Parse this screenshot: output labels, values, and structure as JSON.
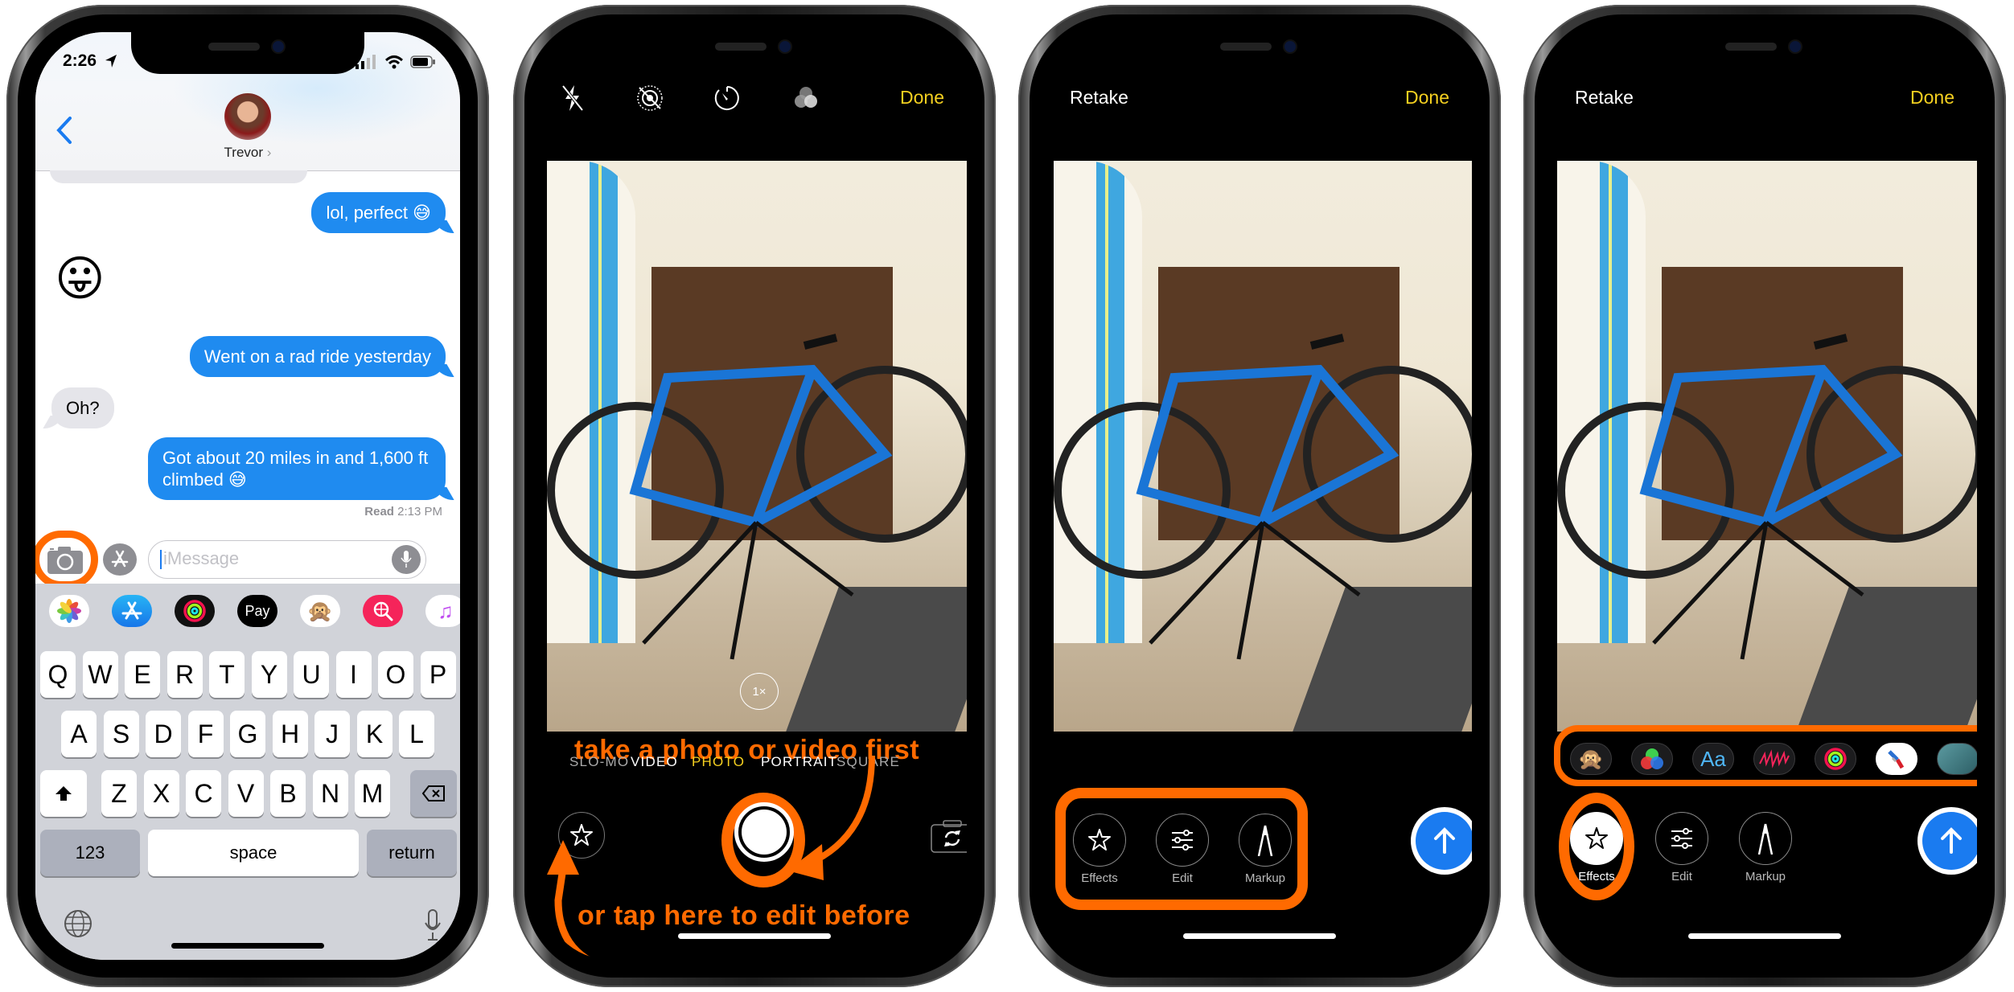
{
  "colors": {
    "imessage_blue": "#1f8bf0",
    "received_gray": "#e5e5ea",
    "annotation_orange": "#ff6a00",
    "camera_yellow": "#f5d020",
    "send_blue": "#1a7bf0"
  },
  "phone1": {
    "status": {
      "time": "2:26",
      "location_icon": "location-arrow-icon",
      "signal_icon": "signal-bars-icon",
      "wifi_icon": "wifi-icon",
      "battery_icon": "battery-icon"
    },
    "header": {
      "back_icon": "chevron-left-icon",
      "contact_name": "Trevor",
      "contact_chevron": "›",
      "avatar": "contact-photo"
    },
    "messages": [
      {
        "direction": "outgoing",
        "text": "lol, perfect 😅"
      },
      {
        "direction": "incoming",
        "text": "😛",
        "type": "emoji-only"
      },
      {
        "direction": "outgoing",
        "text": "Went on a rad ride yesterday"
      },
      {
        "direction": "incoming",
        "text": "Oh?"
      },
      {
        "direction": "outgoing",
        "text": "Got about 20 miles in and 1,600 ft climbed 😅"
      }
    ],
    "read_receipt": {
      "label": "Read",
      "time": "2:13 PM"
    },
    "compose": {
      "camera_icon": "camera-icon",
      "apps_icon": "app-store-icon",
      "placeholder": "iMessage",
      "mic_icon": "microphone-icon"
    },
    "app_strip": [
      {
        "name": "Photos",
        "icon": "photos-icon"
      },
      {
        "name": "App Store",
        "icon": "app-store-icon"
      },
      {
        "name": "Activity",
        "icon": "activity-rings-icon"
      },
      {
        "name": "Apple Pay",
        "label": "Pay",
        "icon": "apple-pay-icon"
      },
      {
        "name": "Animoji",
        "icon": "monkey-animoji-icon"
      },
      {
        "name": "Images",
        "icon": "search-globe-icon"
      },
      {
        "name": "Music",
        "icon": "music-note-icon"
      }
    ],
    "keyboard": {
      "row1": [
        "Q",
        "W",
        "E",
        "R",
        "T",
        "Y",
        "U",
        "I",
        "O",
        "P"
      ],
      "row2": [
        "A",
        "S",
        "D",
        "F",
        "G",
        "H",
        "J",
        "K",
        "L"
      ],
      "row3": [
        "Z",
        "X",
        "C",
        "V",
        "B",
        "N",
        "M"
      ],
      "shift_icon": "shift-arrow-icon",
      "delete_icon": "backspace-icon",
      "numbers_label": "123",
      "space_label": "space",
      "return_label": "return",
      "globe_icon": "globe-icon",
      "dictation_icon": "microphone-icon"
    }
  },
  "phone2": {
    "top_controls": [
      {
        "name": "flash-off",
        "icon": "flash-off-icon"
      },
      {
        "name": "live-photo-off",
        "icon": "live-photo-off-icon"
      },
      {
        "name": "timer",
        "icon": "timer-icon"
      },
      {
        "name": "filters",
        "icon": "filters-icon"
      }
    ],
    "done_label": "Done",
    "zoom_label": "1×",
    "modes": [
      "SLO-MO",
      "VIDEO",
      "PHOTO",
      "PORTRAIT",
      "SQUARE"
    ],
    "selected_mode": "PHOTO",
    "annotation_top": "take a photo or video first",
    "annotation_bottom": "or tap here to edit before",
    "effects_icon": "effects-star-icon",
    "shutter_icon": "shutter-button",
    "flip_icon": "camera-flip-icon"
  },
  "phone3": {
    "retake_label": "Retake",
    "done_label": "Done",
    "tools": [
      {
        "label": "Effects",
        "icon": "effects-star-icon"
      },
      {
        "label": "Edit",
        "icon": "sliders-icon"
      },
      {
        "label": "Markup",
        "icon": "markup-pen-icon"
      }
    ],
    "send_icon": "arrow-up-icon"
  },
  "phone4": {
    "retake_label": "Retake",
    "done_label": "Done",
    "stickers": [
      {
        "name": "Animoji",
        "icon": "monkey-animoji-icon"
      },
      {
        "name": "Filters",
        "icon": "color-filters-icon"
      },
      {
        "name": "Text",
        "label": "Aa",
        "icon": "text-labels-icon"
      },
      {
        "name": "Shapes",
        "icon": "scribble-shapes-icon"
      },
      {
        "name": "Activity",
        "icon": "activity-rings-icon"
      },
      {
        "name": "American Airlines",
        "icon": "american-airlines-icon"
      },
      {
        "name": "Whale",
        "icon": "whale-sticker-icon"
      }
    ],
    "tools": [
      {
        "label": "Effects",
        "icon": "effects-star-icon",
        "selected": true
      },
      {
        "label": "Edit",
        "icon": "sliders-icon"
      },
      {
        "label": "Markup",
        "icon": "markup-pen-icon"
      }
    ],
    "send_icon": "arrow-up-icon"
  }
}
